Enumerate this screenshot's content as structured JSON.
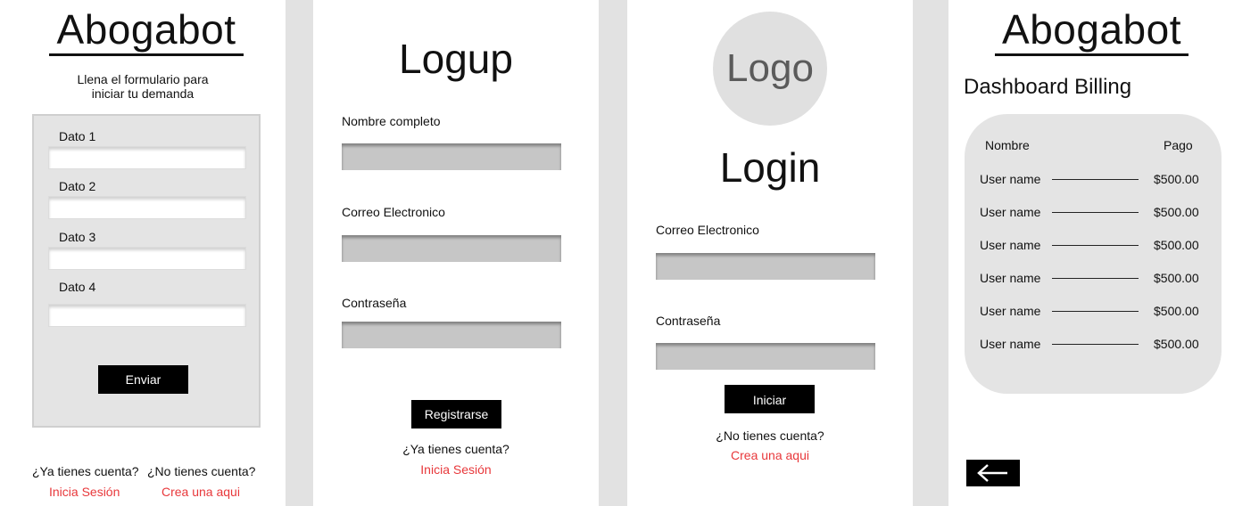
{
  "form_screen": {
    "brand": "Abogabot",
    "subtitle_line1": "Llena el formulario para",
    "subtitle_line2": "iniciar tu demanda",
    "fields": [
      {
        "label": "Dato 1",
        "value": ""
      },
      {
        "label": "Dato 2",
        "value": ""
      },
      {
        "label": "Dato 3",
        "value": ""
      },
      {
        "label": "Dato 4",
        "value": ""
      }
    ],
    "submit_label": "Enviar",
    "have_account": "¿Ya tienes cuenta?",
    "login_link": "Inicia Sesión",
    "no_account": "¿No tienes cuenta?",
    "signup_link": "Crea una aqui"
  },
  "signup_screen": {
    "title": "Logup",
    "fields": [
      {
        "label": "Nombre completo",
        "value": ""
      },
      {
        "label": "Correo Electronico",
        "value": ""
      },
      {
        "label": "Contraseña",
        "value": ""
      }
    ],
    "submit_label": "Registrarse",
    "have_account": "¿Ya tienes cuenta?",
    "login_link": "Inicia Sesión"
  },
  "login_screen": {
    "logo_text": "Logo",
    "title": "Login",
    "fields": [
      {
        "label": "Correo Electronico",
        "value": ""
      },
      {
        "label": "Contraseña",
        "value": ""
      }
    ],
    "submit_label": "Iniciar",
    "no_account": "¿No tienes cuenta?",
    "signup_link": "Crea una aqui"
  },
  "billing_screen": {
    "brand": "Abogabot",
    "title": "Dashboard Billing",
    "col_name": "Nombre",
    "col_payment": "Pago",
    "rows": [
      {
        "name": "User name",
        "amount": "$500.00"
      },
      {
        "name": "User name",
        "amount": "$500.00"
      },
      {
        "name": "User name",
        "amount": "$500.00"
      },
      {
        "name": "User name",
        "amount": "$500.00"
      },
      {
        "name": "User name",
        "amount": "$500.00"
      },
      {
        "name": "User name",
        "amount": "$500.00"
      }
    ],
    "back_icon": "arrow-left-icon"
  }
}
